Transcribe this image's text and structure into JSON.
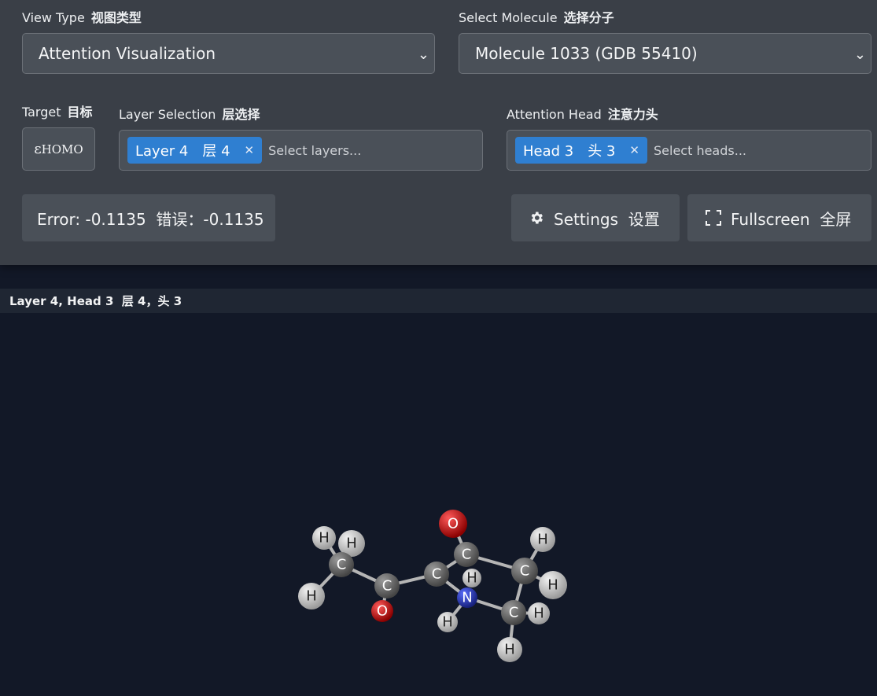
{
  "view_type": {
    "label": "View Type",
    "label_zh": "视图类型",
    "value": "Attention Visualization"
  },
  "molecule": {
    "label": "Select Molecule",
    "label_zh": "选择分子",
    "value": "Molecule 1033 (GDB 55410)"
  },
  "target": {
    "label": "Target",
    "label_zh": "目标",
    "symbol": "ε",
    "subscript": "HOMO"
  },
  "layers": {
    "label": "Layer Selection",
    "label_zh": "层选择",
    "chip": "Layer 4　层 4",
    "placeholder": "Select layers..."
  },
  "heads": {
    "label": "Attention Head",
    "label_zh": "注意力头",
    "chip": "Head 3　头 3",
    "placeholder": "Select heads..."
  },
  "error": {
    "text": "Error: -0.1135  错误：-0.1135"
  },
  "buttons": {
    "settings": "Settings  设置",
    "fullscreen": "Fullscreen  全屏"
  },
  "view_title": "Layer 4, Head 3  层 4，头 3",
  "colors": {
    "chip": "#2f7fd1",
    "oxygen": "#c21010",
    "nitrogen": "#2233aa",
    "carbon": "#5a5a5a",
    "hydrogen": "#c9c9c9",
    "bond": "#b5b5b5"
  },
  "molecule_atoms": {
    "c_methyl": "C",
    "h1": "H",
    "h2": "H",
    "h3": "H",
    "c_carbonyl": "C",
    "o_carbonyl": "O",
    "c_alpha": "C",
    "h_alpha": "H",
    "c_ring": "C",
    "o_ring": "O",
    "c_right": "C",
    "h_r1": "H",
    "h_r2": "H",
    "c_low": "C",
    "h_l1": "H",
    "h_l2": "H",
    "n": "N",
    "h_n": "H"
  }
}
